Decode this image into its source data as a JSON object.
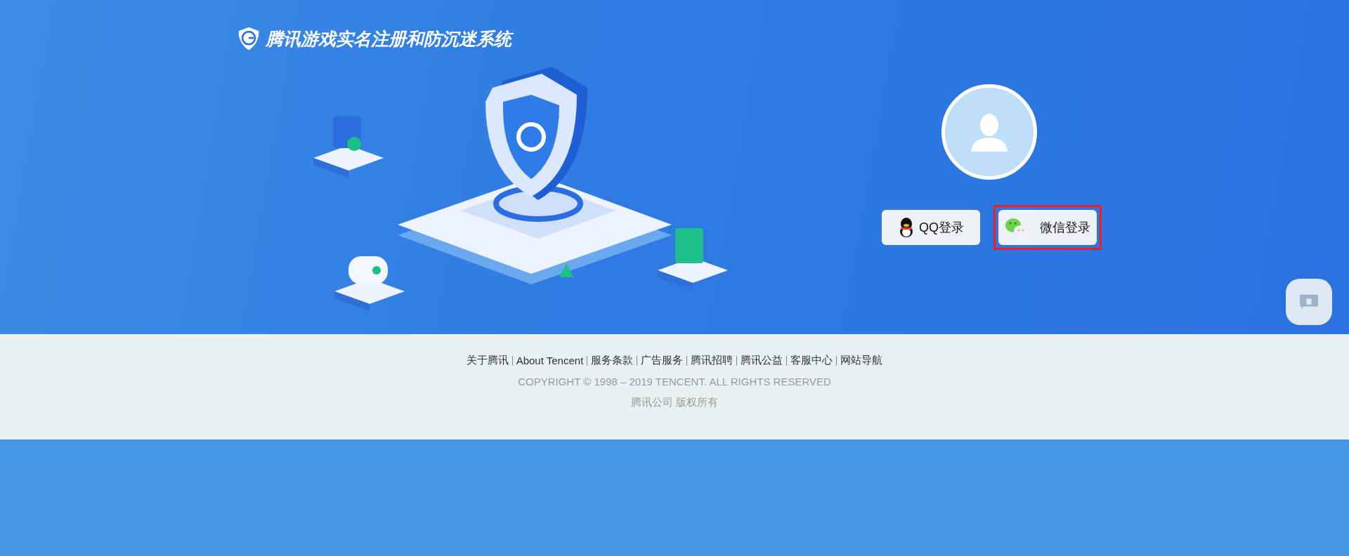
{
  "header": {
    "title": "腾讯游戏实名注册和防沉迷系统"
  },
  "login_buttons": [
    {
      "kind": "qq",
      "label": "QQ登录",
      "highlighted": false
    },
    {
      "kind": "wechat",
      "label": "微信登录",
      "highlighted": true
    }
  ],
  "footer": {
    "links": [
      "关于腾讯",
      "About Tencent",
      "服务条款",
      "广告服务",
      "腾讯招聘",
      "腾讯公益",
      "客服中心",
      "网站导航"
    ],
    "copyright": "COPYRIGHT © 1998 – 2019 TENCENT. ALL RIGHTS RESERVED",
    "company": "腾讯公司 版权所有"
  }
}
